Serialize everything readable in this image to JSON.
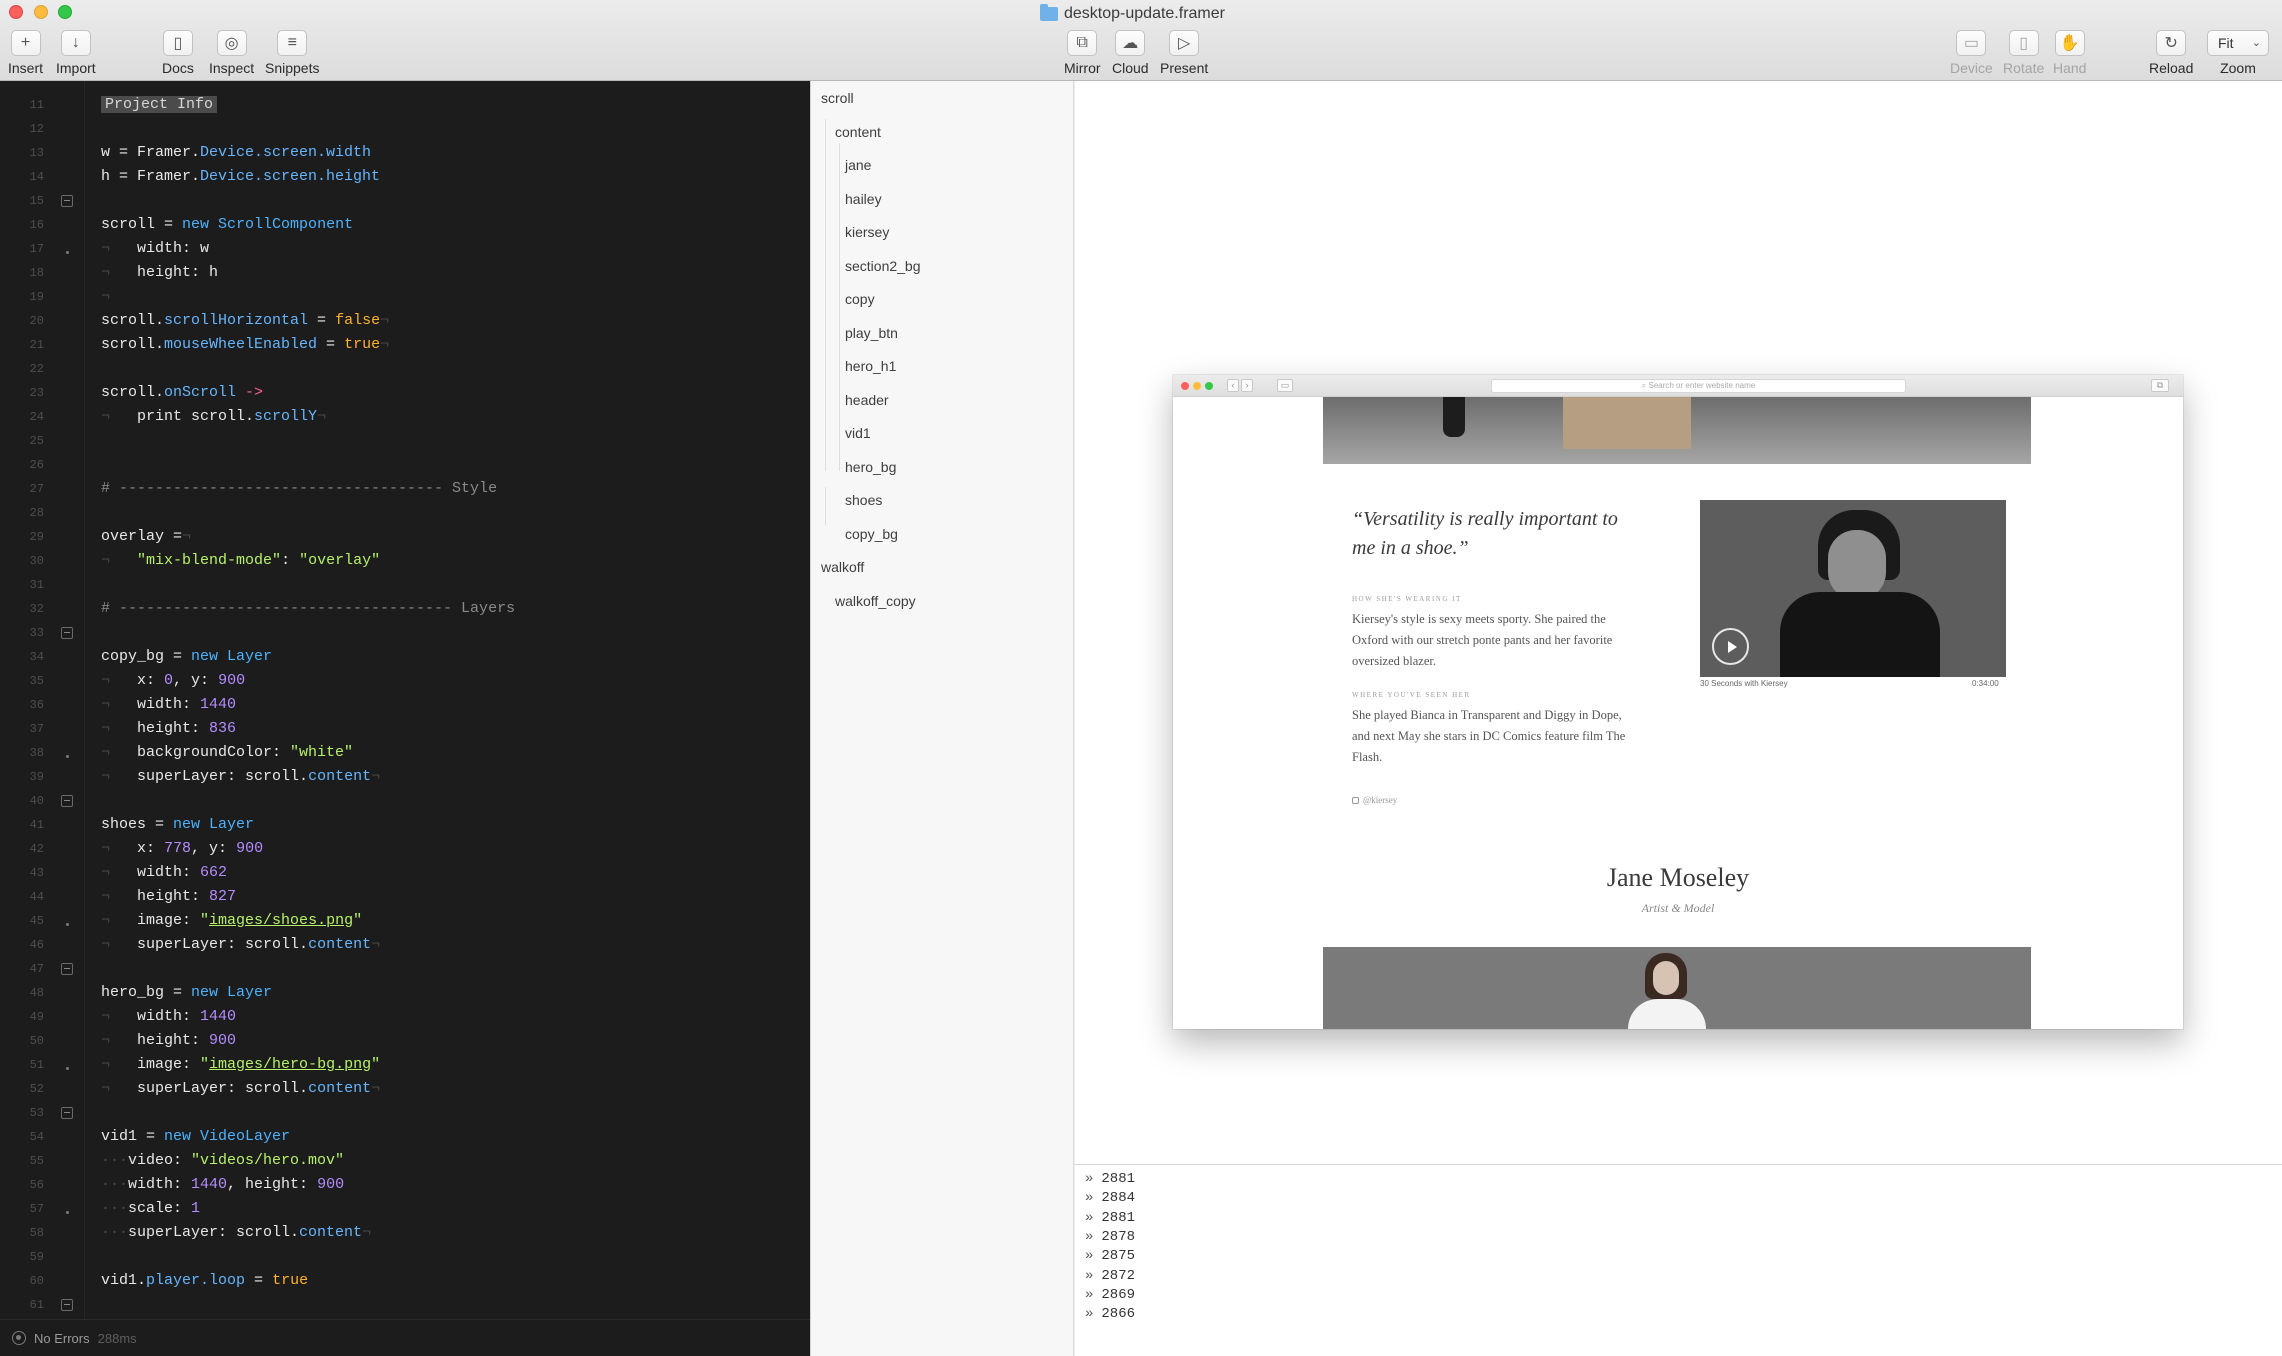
{
  "window": {
    "title": "desktop-update.framer"
  },
  "toolbar": {
    "insert": "Insert",
    "import": "Import",
    "docs": "Docs",
    "inspect": "Inspect",
    "snippets": "Snippets",
    "mirror": "Mirror",
    "cloud": "Cloud",
    "present": "Present",
    "device": "Device",
    "rotate": "Rotate",
    "hand": "Hand",
    "reload": "Reload",
    "zoom": "Zoom",
    "zoom_value": "Fit"
  },
  "editor": {
    "project_info": "Project Info",
    "status": "No Errors",
    "status_time": "288ms",
    "line_numbers": [
      "11",
      "12",
      "13",
      "14",
      "15",
      "16",
      "17",
      "18",
      "19",
      "20",
      "21",
      "22",
      "23",
      "24",
      "25",
      "26",
      "27",
      "28",
      "29",
      "30",
      "31",
      "32",
      "33",
      "34",
      "35",
      "36",
      "37",
      "38",
      "39",
      "40",
      "41",
      "42",
      "43",
      "44",
      "45",
      "46",
      "47",
      "48",
      "49",
      "50",
      "51",
      "52",
      "53",
      "54",
      "55",
      "56",
      "57",
      "58",
      "59",
      "60",
      "61"
    ]
  },
  "layers": {
    "items": [
      {
        "label": "scroll"
      },
      {
        "label": "content"
      },
      {
        "label": "jane"
      },
      {
        "label": "hailey"
      },
      {
        "label": "kiersey"
      },
      {
        "label": "section2_bg"
      },
      {
        "label": "copy"
      },
      {
        "label": "play_btn"
      },
      {
        "label": "hero_h1"
      },
      {
        "label": "header"
      },
      {
        "label": "vid1"
      },
      {
        "label": "hero_bg"
      },
      {
        "label": "shoes"
      },
      {
        "label": "copy_bg"
      },
      {
        "label": "walkoff"
      },
      {
        "label": "walkoff_copy"
      }
    ]
  },
  "preview": {
    "url_placeholder": "Search or enter website name",
    "quote": "“Versatility is really important to me in a shoe.”",
    "wearing_label": "How she's wearing it",
    "wearing_text": "Kiersey's style is sexy meets sporty. She paired the Oxford with our stretch ponte pants and her favorite oversized blazer.",
    "seen_label": "Where you've seen her",
    "seen_text": "She played Bianca in Transparent and Diggy in Dope, and next May she stars in DC Comics feature film The Flash.",
    "instagram": "@kiersey",
    "video_caption": "30 Seconds with Kiersey",
    "video_duration": "0:34:00",
    "name": "Jane Moseley",
    "role": "Artist & Model"
  },
  "console": {
    "lines": [
      "2881",
      "2884",
      "2881",
      "2878",
      "2875",
      "2872",
      "2869",
      "2866"
    ]
  },
  "colors": {
    "editor_bg": "#1c1c1c",
    "keyword": "#4db3ff",
    "boolean": "#ffb12e",
    "number": "#b58cff",
    "string": "#b6f268",
    "arrow": "#ff5fa2"
  }
}
